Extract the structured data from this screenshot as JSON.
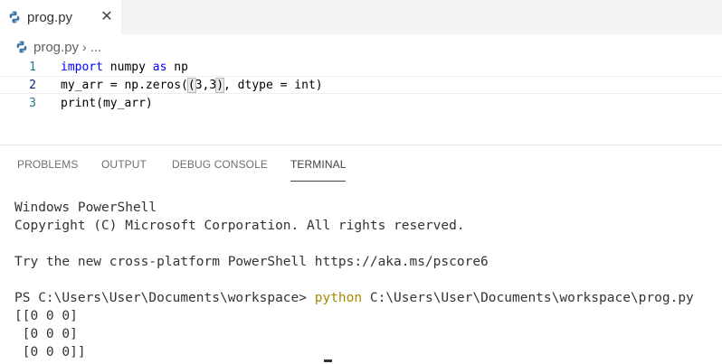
{
  "editor_tab": {
    "icon": "python-icon",
    "label": "prog.py",
    "close_glyph": "✕"
  },
  "breadcrumb": {
    "file": "prog.py",
    "separator": "›",
    "more": "..."
  },
  "editor": {
    "lines": [
      {
        "number": "1",
        "keyword": "import",
        "rest_a": " numpy ",
        "keyword2": "as",
        "rest_b": " np"
      },
      {
        "number": "2",
        "pre": "my_arr = np.zeros(",
        "open": "(",
        "mid": "3,3",
        "close": ")",
        "post": ", dtype = int)"
      },
      {
        "number": "3",
        "text": "print(my_arr)"
      }
    ]
  },
  "panel": {
    "tabs": [
      "PROBLEMS",
      "OUTPUT",
      "DEBUG CONSOLE",
      "TERMINAL"
    ],
    "active_tab": "TERMINAL"
  },
  "terminal": {
    "lines": [
      "Windows PowerShell",
      "Copyright (C) Microsoft Corporation. All rights reserved.",
      "",
      "Try the new cross-platform PowerShell https://aka.ms/pscore6",
      ""
    ],
    "prompt": "PS C:\\Users\\User\\Documents\\workspace> ",
    "command": "python",
    "args": " C:\\Users\\User\\Documents\\workspace\\prog.py",
    "output": [
      "[[0 0 0]",
      " [0 0 0]",
      " [0 0 0]]"
    ]
  },
  "colors": {
    "keyword": "#0000ff",
    "command": "#a58b00",
    "line_number": "#237893"
  }
}
